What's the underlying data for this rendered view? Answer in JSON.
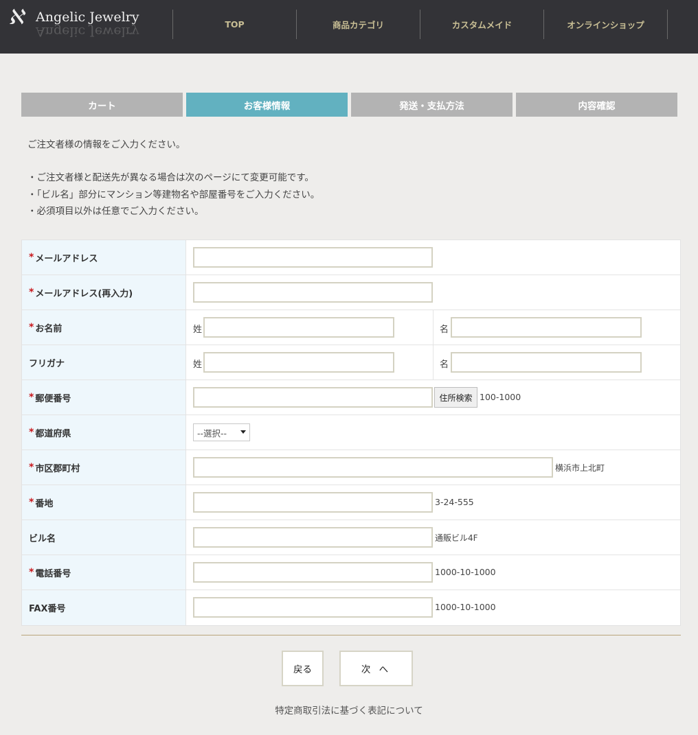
{
  "header": {
    "logo_mark": "ℵ",
    "logo_text": "Angelic Jewelry",
    "nav": [
      {
        "label": "TOP"
      },
      {
        "label": "商品カテゴリ"
      },
      {
        "label": "カスタムメイド"
      },
      {
        "label": "オンラインショップ"
      }
    ]
  },
  "steps": [
    {
      "label": "カート"
    },
    {
      "label": "お客様情報"
    },
    {
      "label": "発送・支払方法"
    },
    {
      "label": "内容確認"
    }
  ],
  "intro": "ご注文者様の情報をご入力ください。",
  "notes": [
    "・ご注文者様と配送先が異なる場合は次のページにて変更可能です。",
    "・「ビル名」部分にマンション等建物名や部屋番号をご入力ください。",
    "・必須項目以外は任意でご入力ください。"
  ],
  "form": {
    "required_mark": "*",
    "email": {
      "label": "メールアドレス",
      "value": ""
    },
    "email_confirm": {
      "label": "メールアドレス(再入力)",
      "value": ""
    },
    "name": {
      "label": "お名前",
      "last_label": "姓",
      "first_label": "名",
      "last_value": "",
      "first_value": ""
    },
    "kana": {
      "label": "フリガナ",
      "last_label": "姓",
      "first_label": "名",
      "last_value": "",
      "first_value": ""
    },
    "postal": {
      "label": "郵便番号",
      "value": "",
      "search_button": "住所検索",
      "hint": "100-1000"
    },
    "prefecture": {
      "label": "都道府県",
      "selected": "--選択--"
    },
    "city": {
      "label": "市区郡町村",
      "value": "",
      "hint": "横浜市上北町"
    },
    "street": {
      "label": "番地",
      "value": "",
      "hint": "3-24-555"
    },
    "building": {
      "label": "ビル名",
      "value": "",
      "hint": "通販ビル4F"
    },
    "phone": {
      "label": "電話番号",
      "value": "",
      "hint": "1000-10-1000"
    },
    "fax": {
      "label": "FAX番号",
      "value": "",
      "hint": "1000-10-1000"
    }
  },
  "buttons": {
    "back": "戻る",
    "next": "次 へ"
  },
  "footer_link": "特定商取引法に基づく表記について"
}
